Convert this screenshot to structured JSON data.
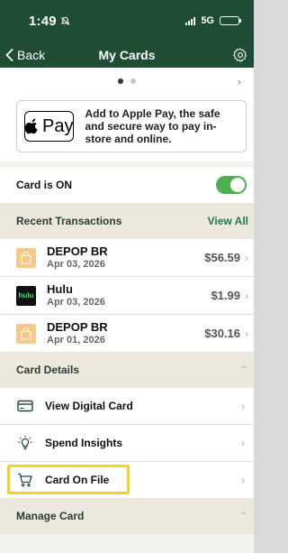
{
  "status_bar": {
    "time": "1:49",
    "network": "5G"
  },
  "nav": {
    "back_label": "Back",
    "title": "My Cards",
    "settings_icon": "gear-icon"
  },
  "pager": {
    "dots": 2,
    "active": 0
  },
  "apple_pay": {
    "badge_text": "Pay",
    "message": "Add to Apple Pay, the safe and secure way to pay in-store and online."
  },
  "card_status": {
    "label": "Card is ON",
    "on": true
  },
  "recent": {
    "title": "Recent Transactions",
    "view_all": "View All",
    "items": [
      {
        "merchant": "DEPOP BR",
        "date": "Apr 03, 2026",
        "amount": "$56.59",
        "icon": "shopping-bag-icon"
      },
      {
        "merchant": "Hulu",
        "date": "Apr 03, 2026",
        "amount": "$1.99",
        "icon": "hulu-logo",
        "logo_text": "hulu"
      },
      {
        "merchant": "DEPOP BR",
        "date": "Apr 01, 2026",
        "amount": "$30.16",
        "icon": "shopping-bag-icon"
      }
    ]
  },
  "card_details": {
    "title": "Card Details",
    "items": [
      {
        "label": "View Digital Card",
        "icon": "card-icon"
      },
      {
        "label": "Spend Insights",
        "icon": "lightbulb-icon"
      },
      {
        "label": "Card On File",
        "icon": "cart-icon",
        "highlighted": true
      }
    ]
  },
  "manage_card": {
    "title": "Manage Card"
  },
  "colors": {
    "header": "#1e4d33",
    "accent": "#1e7b43",
    "toggle_on": "#4caf50",
    "highlight": "#f6d21c"
  }
}
